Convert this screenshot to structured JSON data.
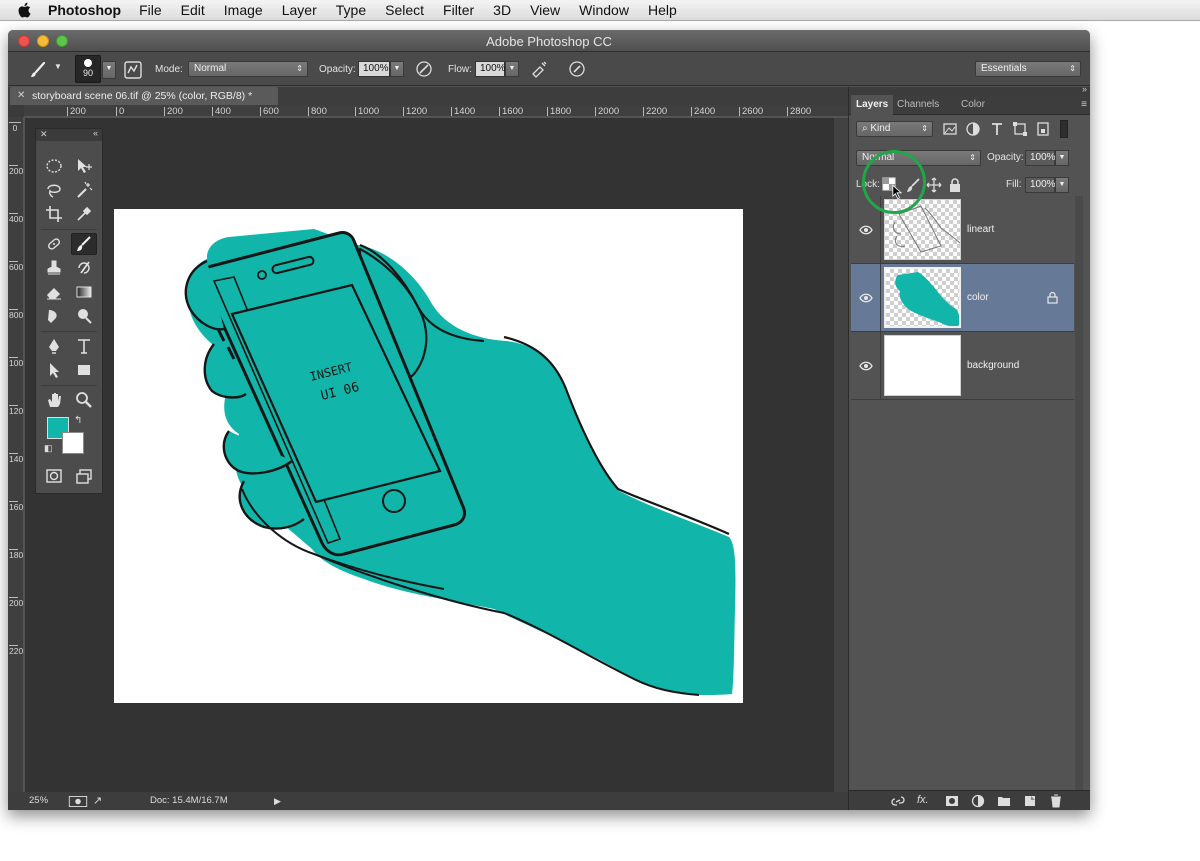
{
  "menubar": {
    "app": "Photoshop",
    "items": [
      "File",
      "Edit",
      "Image",
      "Layer",
      "Type",
      "Select",
      "Filter",
      "3D",
      "View",
      "Window",
      "Help"
    ]
  },
  "window": {
    "title": "Adobe Photoshop CC"
  },
  "options": {
    "brush_size": "90",
    "mode_label": "Mode:",
    "mode_value": "Normal",
    "opacity_label": "Opacity:",
    "opacity_value": "100%",
    "flow_label": "Flow:",
    "flow_value": "100%",
    "workspace": "Essentials"
  },
  "document": {
    "tab_title": "storyboard scene 06.tif @ 25% (color, RGB/8) *",
    "ruler_h": [
      "200",
      "0",
      "200",
      "400",
      "600",
      "800",
      "1000",
      "1200",
      "1400",
      "1600",
      "1800",
      "2000",
      "2200",
      "2400",
      "2600",
      "2800"
    ],
    "ruler_v": [
      "0",
      "200",
      "400",
      "600",
      "800",
      "1000",
      "1200",
      "1400",
      "1600",
      "1800",
      "2000",
      "2200"
    ],
    "screen_text": [
      "INSERT",
      "UI 06"
    ],
    "colors": {
      "fill": "#11b5a9",
      "canvas_bg": "#333333"
    }
  },
  "status": {
    "zoom": "25%",
    "doc_info": "Doc: 15.4M/16.7M"
  },
  "colors": {
    "foreground": "#11b5a9",
    "background": "#ffffff",
    "accent_circle": "#21a64a",
    "selected_layer": "#667a97"
  },
  "panels": {
    "tabs": [
      "Layers",
      "Channels",
      "Color"
    ],
    "filter_kind": "Kind",
    "blend_mode": "Normal",
    "opacity_label": "Opacity:",
    "opacity_value": "100%",
    "lock_label": "Lock:",
    "fill_label": "Fill:",
    "fill_value": "100%"
  },
  "layers": [
    {
      "name": "lineart",
      "selected": false,
      "locked": false
    },
    {
      "name": "color",
      "selected": true,
      "locked": true
    },
    {
      "name": "background",
      "selected": false,
      "locked": false
    }
  ]
}
